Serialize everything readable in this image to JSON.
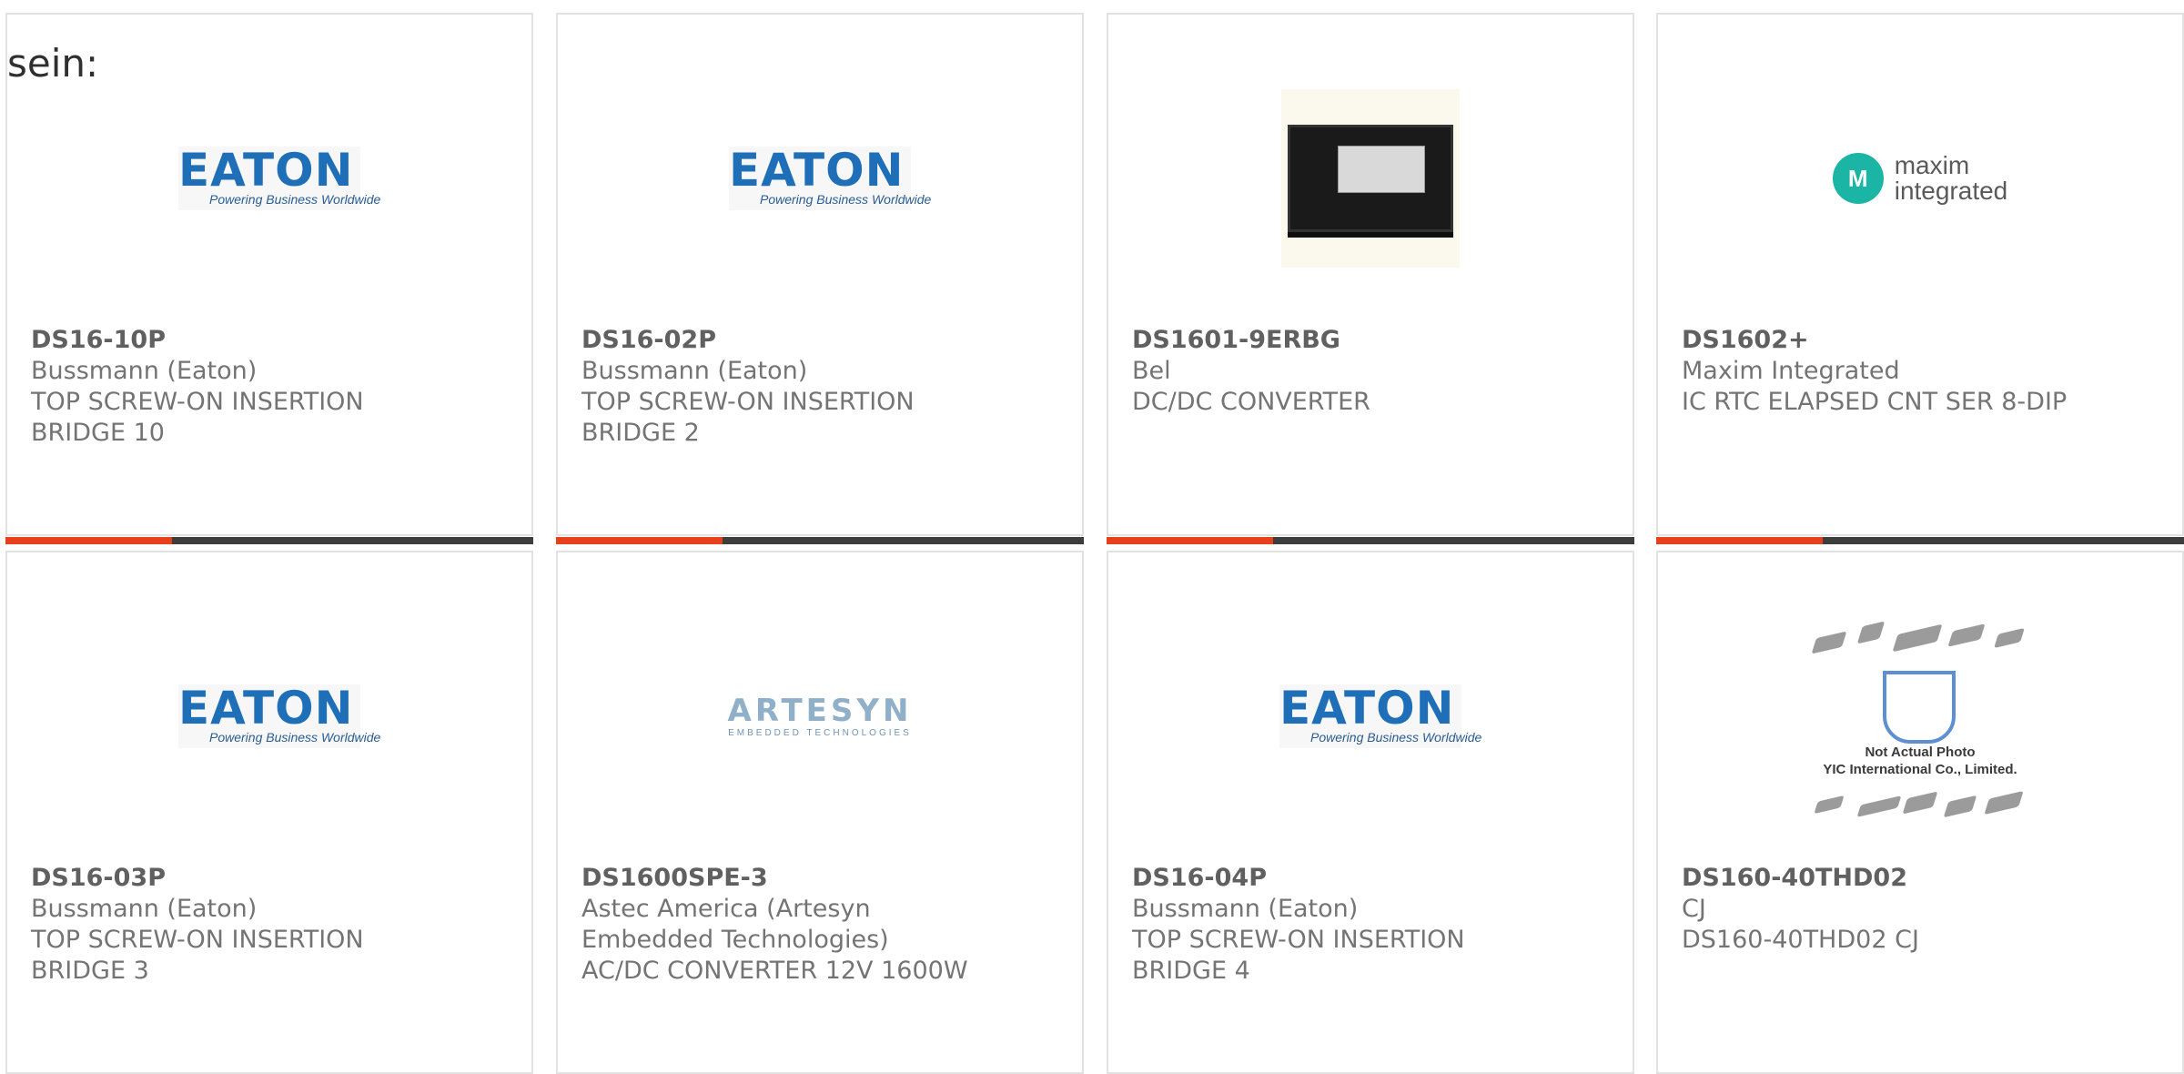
{
  "intro_text": "sein:",
  "products": [
    {
      "part": "DS16-10P",
      "manufacturer": "Bussmann (Eaton)",
      "description_lines": [
        "TOP SCREW-ON INSERTION",
        "BRIDGE 10"
      ],
      "image": "eaton-logo"
    },
    {
      "part": "DS16-02P",
      "manufacturer": "Bussmann (Eaton)",
      "description_lines": [
        "TOP SCREW-ON INSERTION",
        "BRIDGE 2"
      ],
      "image": "eaton-logo"
    },
    {
      "part": "DS1601-9ERBG",
      "manufacturer": "Bel",
      "description_lines": [
        "DC/DC CONVERTER"
      ],
      "image": "converter-photo"
    },
    {
      "part": "DS1602+",
      "manufacturer": "Maxim Integrated",
      "description_lines": [
        "IC RTC ELAPSED CNT SER 8-DIP"
      ],
      "image": "maxim-logo"
    },
    {
      "part": "DS16-03P",
      "manufacturer": "Bussmann (Eaton)",
      "description_lines": [
        "TOP SCREW-ON INSERTION",
        "BRIDGE 3"
      ],
      "image": "eaton-logo"
    },
    {
      "part": "DS1600SPE-3",
      "manufacturer": "Astec America (Artesyn Embedded Technologies)",
      "manufacturer_lines": [
        "Astec America (Artesyn",
        "Embedded Technologies)"
      ],
      "description_lines": [
        "AC/DC CONVERTER 12V 1600W"
      ],
      "image": "artesyn-logo"
    },
    {
      "part": "DS16-04P",
      "manufacturer": "Bussmann (Eaton)",
      "description_lines": [
        "TOP SCREW-ON INSERTION",
        "BRIDGE 4"
      ],
      "image": "eaton-logo"
    },
    {
      "part": "DS160-40THD02",
      "manufacturer": "CJ",
      "description_lines": [
        "DS160-40THD02 CJ"
      ],
      "image": "yic-placeholder"
    }
  ],
  "logos": {
    "eaton": {
      "word": "EATON",
      "tagline": "Powering Business Worldwide"
    },
    "maxim": {
      "mark": "M",
      "line1": "maxim",
      "line2": "integrated"
    },
    "artesyn": {
      "word": "ARTESYN",
      "sub": "EMBEDDED TECHNOLOGIES"
    },
    "yic": {
      "line1": "Not Actual Photo",
      "line2": "YIC International Co., Limited."
    }
  },
  "colors": {
    "accent": "#e8401c",
    "bar": "#3d3d3d",
    "eaton_blue": "#1e6fb8",
    "maxim_teal": "#1bb5a6"
  }
}
